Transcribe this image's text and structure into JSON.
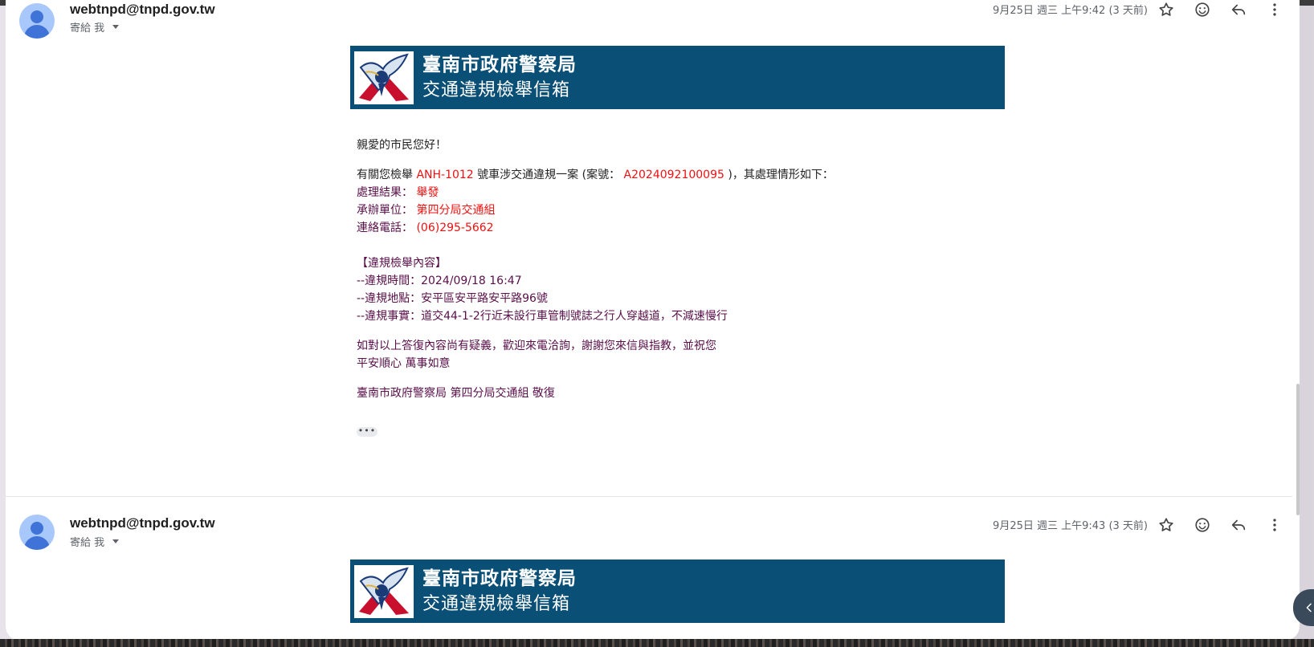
{
  "messages": [
    {
      "sender": "webtnpd@tnpd.gov.tw",
      "to_label": "寄給 我",
      "date": "9月25日 週三 上午9:42 (3 天前)",
      "banner": {
        "title": "臺南市政府警察局",
        "subtitle": "交通違規檢舉信箱"
      }
    },
    {
      "sender": "webtnpd@tnpd.gov.tw",
      "to_label": "寄給 我",
      "date": "9月25日 週三 上午9:43 (3 天前)",
      "banner": {
        "title": "臺南市政府警察局",
        "subtitle": "交通違規檢舉信箱"
      }
    }
  ],
  "body": {
    "greeting": "親愛的市民您好！",
    "intro_prefix": "有關您檢舉 ",
    "plate": "ANH-1012",
    "intro_middle": " 號車涉交通違規一案 (案號： ",
    "case_no": "A2024092100095",
    "intro_suffix": " )，其處理情形如下：",
    "result_label": "處理結果：",
    "result_value": " 舉發",
    "unit_label": "承辦單位：",
    "unit_value": " 第四分局交通組",
    "phone_label": "連絡電話：",
    "phone_value": " (06)295-5662",
    "section_title": "【違規檢舉內容】",
    "time_label": "--違規時間：",
    "time_value": "2024/09/18 16:47",
    "place_label": "--違規地點：",
    "place_value": "安平區安平路安平路96號",
    "fact_label": "--違規事實：",
    "fact_value": "道交44-1-2行近未設行車管制號誌之行人穿越道，不減速慢行",
    "closing_1": "如對以上答復內容尚有疑義，歡迎來電洽詢，謝謝您來信與指教，並祝您",
    "closing_2": "平安順心 萬事如意",
    "signature": "臺南市政府警察局 第四分局交通組 敬復",
    "ellipsis": "•••"
  },
  "icons": {
    "star": "star-icon",
    "emoji": "emoji-icon",
    "reply": "reply-icon",
    "more": "more-vert-icon",
    "side_toggle": "chevron-left-icon"
  },
  "colors": {
    "banner_bg": "#0a4f76",
    "highlight_red": "#ee1111",
    "body_purple": "#5a0f4a",
    "avatar_bg": "#a8c7fa"
  }
}
